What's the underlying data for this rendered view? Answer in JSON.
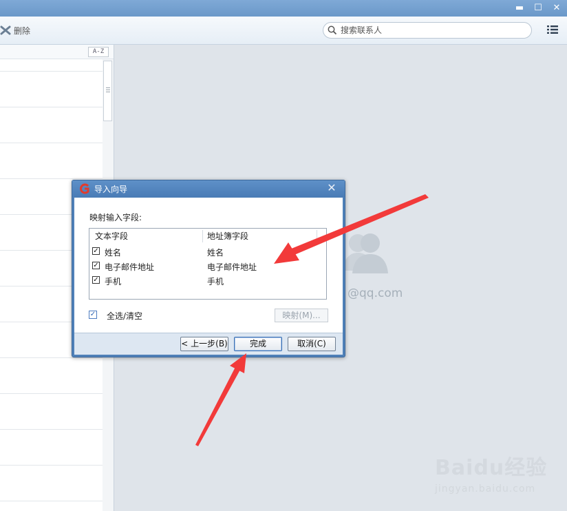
{
  "window": {
    "controls": [
      "▬",
      "☐",
      "✕"
    ]
  },
  "toolbar": {
    "delete_label": "删除",
    "search_placeholder": "搜索联系人"
  },
  "contact_list": {
    "sort_button": "A-Z"
  },
  "background": {
    "email_partial": "@qq.com"
  },
  "dialog": {
    "title": "导入向导",
    "close": "✕",
    "mapping_label": "映射输入字段:",
    "columns": {
      "text_field": "文本字段",
      "addressbook_field": "地址簿字段"
    },
    "rows": [
      {
        "checked": true,
        "source": "姓名",
        "target": "姓名"
      },
      {
        "checked": true,
        "source": "电子邮件地址",
        "target": "电子邮件地址"
      },
      {
        "checked": true,
        "source": "手机",
        "target": "手机"
      }
    ],
    "select_all_label": "全选/清空",
    "map_button": "映射(M)...",
    "back_button": "< 上一步(B)",
    "finish_button": "完成",
    "cancel_button": "取消(C)"
  },
  "watermark": {
    "main": "Baidu经验",
    "sub": "jingyan.baidu.com"
  },
  "colors": {
    "titlebar": "#7fa9d6",
    "dialog_frame": "#4f80b8",
    "annotation_arrow": "#f23a3a"
  }
}
